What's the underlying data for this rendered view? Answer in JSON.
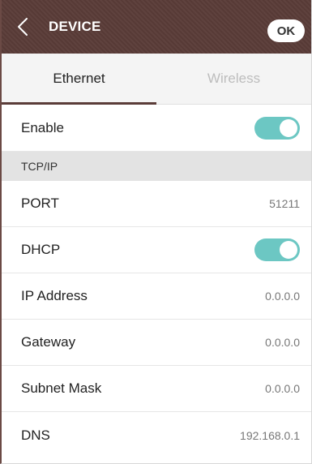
{
  "header": {
    "title": "DEVICE",
    "ok_label": "OK"
  },
  "tabs": [
    {
      "label": "Ethernet",
      "active": true
    },
    {
      "label": "Wireless",
      "active": false
    }
  ],
  "enable": {
    "label": "Enable",
    "on": true
  },
  "section": {
    "title": "TCP/IP"
  },
  "settings": {
    "port": {
      "label": "PORT",
      "value": "51211"
    },
    "dhcp": {
      "label": "DHCP",
      "on": true
    },
    "ip_address": {
      "label": "IP Address",
      "value": "0.0.0.0"
    },
    "gateway": {
      "label": "Gateway",
      "value": "0.0.0.0"
    },
    "subnet_mask": {
      "label": "Subnet Mask",
      "value": "0.0.0.0"
    },
    "dns": {
      "label": "DNS",
      "value": "192.168.0.1"
    }
  },
  "colors": {
    "header_bg": "#5a3c38",
    "toggle_on": "#6cc7c3"
  },
  "icons": {
    "back": "chevron-left-icon"
  }
}
